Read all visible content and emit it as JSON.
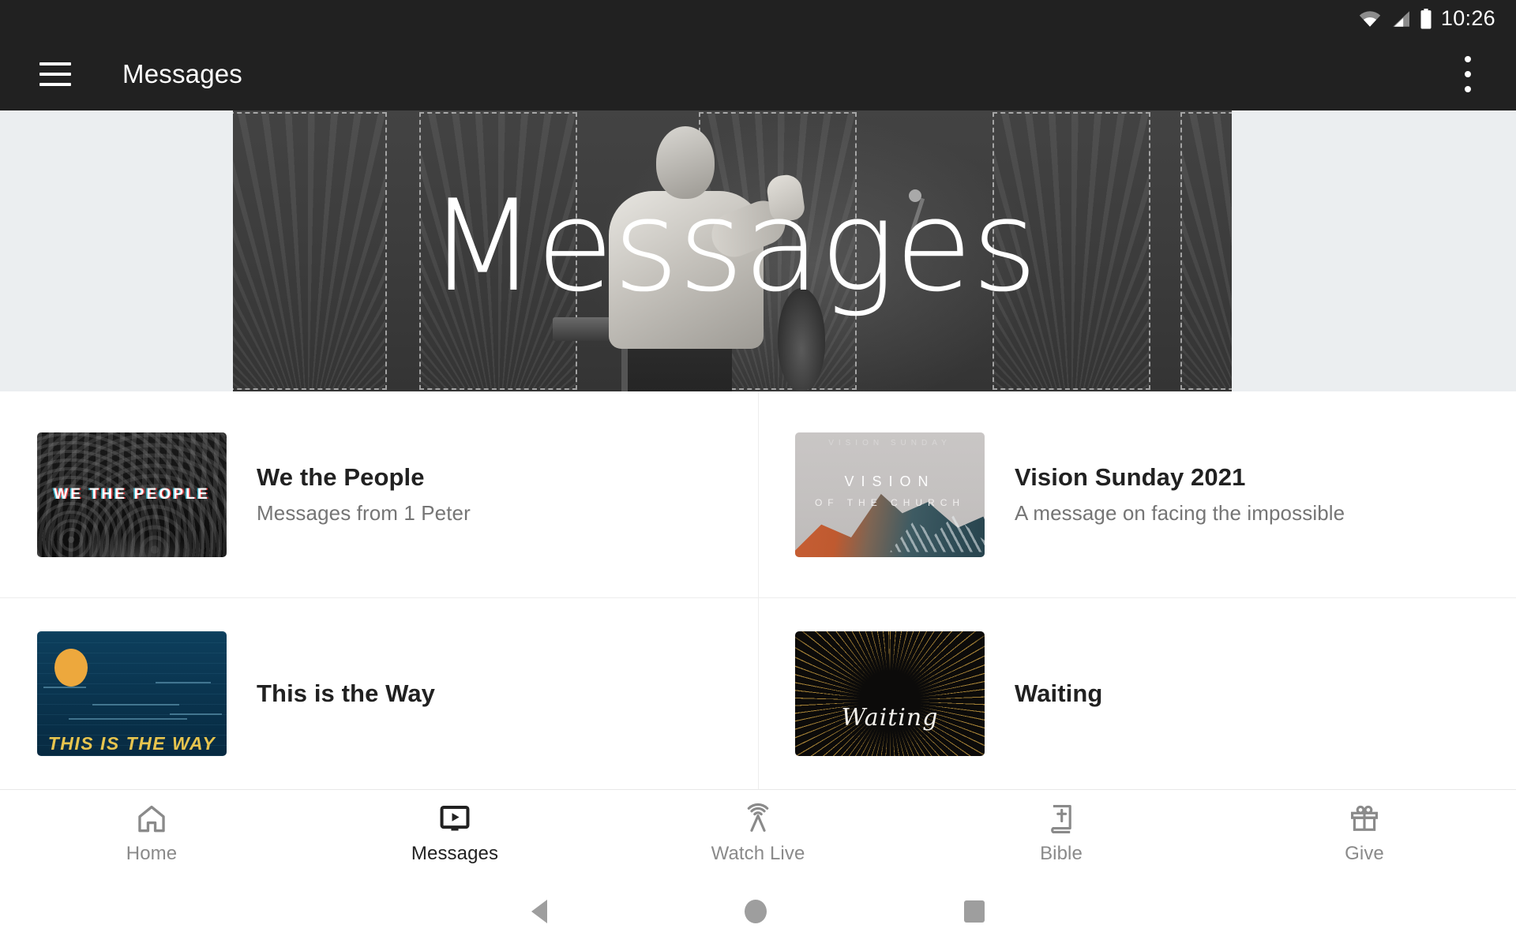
{
  "status_bar": {
    "time": "10:26",
    "icons": [
      "wifi-icon",
      "cellular-signal-icon",
      "battery-icon"
    ]
  },
  "app_bar": {
    "menu_icon": "hamburger-menu-icon",
    "title": "Messages",
    "overflow_icon": "overflow-menu-icon"
  },
  "hero": {
    "title": "Messages",
    "alt": "Speaker at podium with dashed panel backdrop",
    "letterbox_color": "#ebeef0",
    "background_color": "#3d3d3d"
  },
  "series": [
    {
      "title": "We the People",
      "subtitle": "Messages from 1 Peter",
      "thumb_label": "WE THE PEOPLE",
      "thumb_name": "we-the-people-thumbnail"
    },
    {
      "title": "Vision Sunday 2021",
      "subtitle": "A message on facing the impossible",
      "thumb_label_top": "VISION",
      "thumb_label_bottom": "OF THE CHURCH",
      "thumb_label_faint": "VISION SUNDAY",
      "thumb_name": "vision-sunday-thumbnail"
    },
    {
      "title": "This is the Way",
      "subtitle": "",
      "thumb_label": "THIS IS THE WAY",
      "thumb_name": "this-is-the-way-thumbnail"
    },
    {
      "title": "Waiting",
      "subtitle": "",
      "thumb_label": "Waiting",
      "thumb_name": "waiting-thumbnail"
    }
  ],
  "bottom_nav": {
    "items": [
      {
        "label": "Home",
        "icon": "home-icon",
        "active": false
      },
      {
        "label": "Messages",
        "icon": "video-screen-icon",
        "active": true
      },
      {
        "label": "Watch Live",
        "icon": "broadcast-icon",
        "active": false
      },
      {
        "label": "Bible",
        "icon": "bible-book-icon",
        "active": false
      },
      {
        "label": "Give",
        "icon": "gift-icon",
        "active": false
      }
    ],
    "active_color": "#212121",
    "inactive_color": "#8a8a8a"
  },
  "android_nav": {
    "back": "back-triangle-icon",
    "home": "home-circle-icon",
    "recents": "recents-square-icon"
  }
}
